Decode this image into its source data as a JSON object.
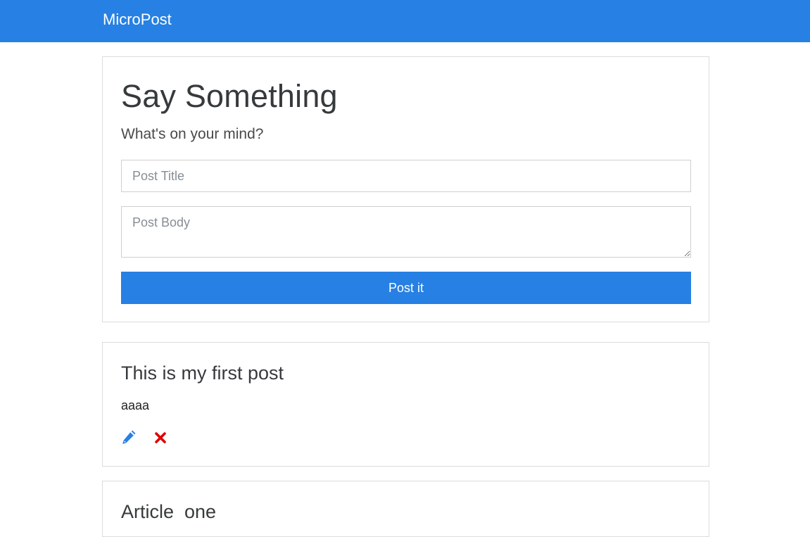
{
  "navbar": {
    "brand": "MicroPost",
    "background": "#2780e3"
  },
  "composer": {
    "title": "Say Something",
    "lead": "What's on your mind?",
    "title_input": {
      "placeholder": "Post Title",
      "value": ""
    },
    "body_input": {
      "placeholder": "Post Body",
      "value": ""
    },
    "submit_label": "Post it"
  },
  "posts": [
    {
      "title": "This is my first post",
      "body": "aaaa",
      "edit_icon": "pencil-icon",
      "delete_icon": "remove-icon"
    },
    {
      "title": "Article  one"
    }
  ],
  "colors": {
    "accent": "#2780e3",
    "edit_icon": "#2780e3",
    "delete_icon": "#e00000"
  }
}
